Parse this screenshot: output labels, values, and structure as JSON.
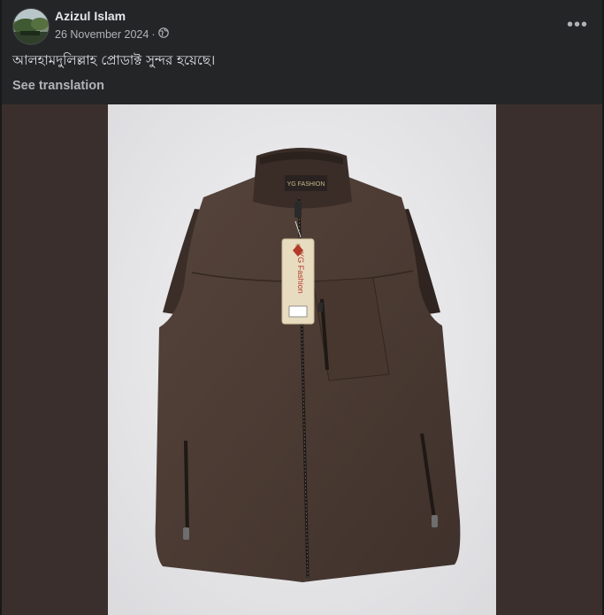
{
  "post": {
    "author": "Azizul Islam",
    "date": "26 November 2024",
    "separator": "·",
    "privacy_icon": "globe-icon",
    "more_icon": "more-options-icon",
    "text": "আলহামদুলিল্লাহ প্রোডাক্ট সুন্দর হয়েছে।",
    "see_translation": "See translation"
  },
  "photo": {
    "subject": "brown fleece-lined vest with hang tag",
    "tag_brand": "YG Fashion",
    "collar_label": "YG FASHION"
  },
  "colors": {
    "card_bg": "#242526",
    "page_bg": "#18191a",
    "text_primary": "#e4e6eb",
    "text_secondary": "#b0b3b8",
    "photo_backdrop": "#3a2f2c",
    "vest_brown": "#4a3a33"
  }
}
